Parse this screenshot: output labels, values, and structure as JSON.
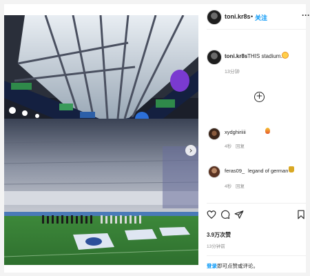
{
  "post": {
    "username": "toni.kr8s",
    "follow_label": "关注",
    "separator": "•",
    "more_label": "···",
    "next_label": "›",
    "caption": {
      "username": "toni.kr8s",
      "text": "THIS stadium...",
      "emoji": "heart-eyes-emoji",
      "time": "13分钟"
    },
    "add_comment_label": "+",
    "comments": [
      {
        "username": "xydghiriiii",
        "text": "",
        "emoji": "fire-emoji",
        "time": "4秒",
        "reply_label": "回复"
      },
      {
        "username": "feras09_",
        "text": "legand of german♡",
        "emoji": "trophy-emoji",
        "time": "4秒",
        "reply_label": "回复"
      }
    ],
    "likes": "3.9万次赞",
    "post_time": "13分钟前",
    "login_link": "登录",
    "login_suffix": "即可点赞或评论。"
  },
  "icons": {
    "like": "heart-icon",
    "comment": "comment-icon",
    "share": "send-icon",
    "save": "bookmark-icon",
    "next": "chevron-right-icon"
  },
  "colors": {
    "link": "#0095f6",
    "meta": "#8e8e8e",
    "text": "#262626"
  }
}
